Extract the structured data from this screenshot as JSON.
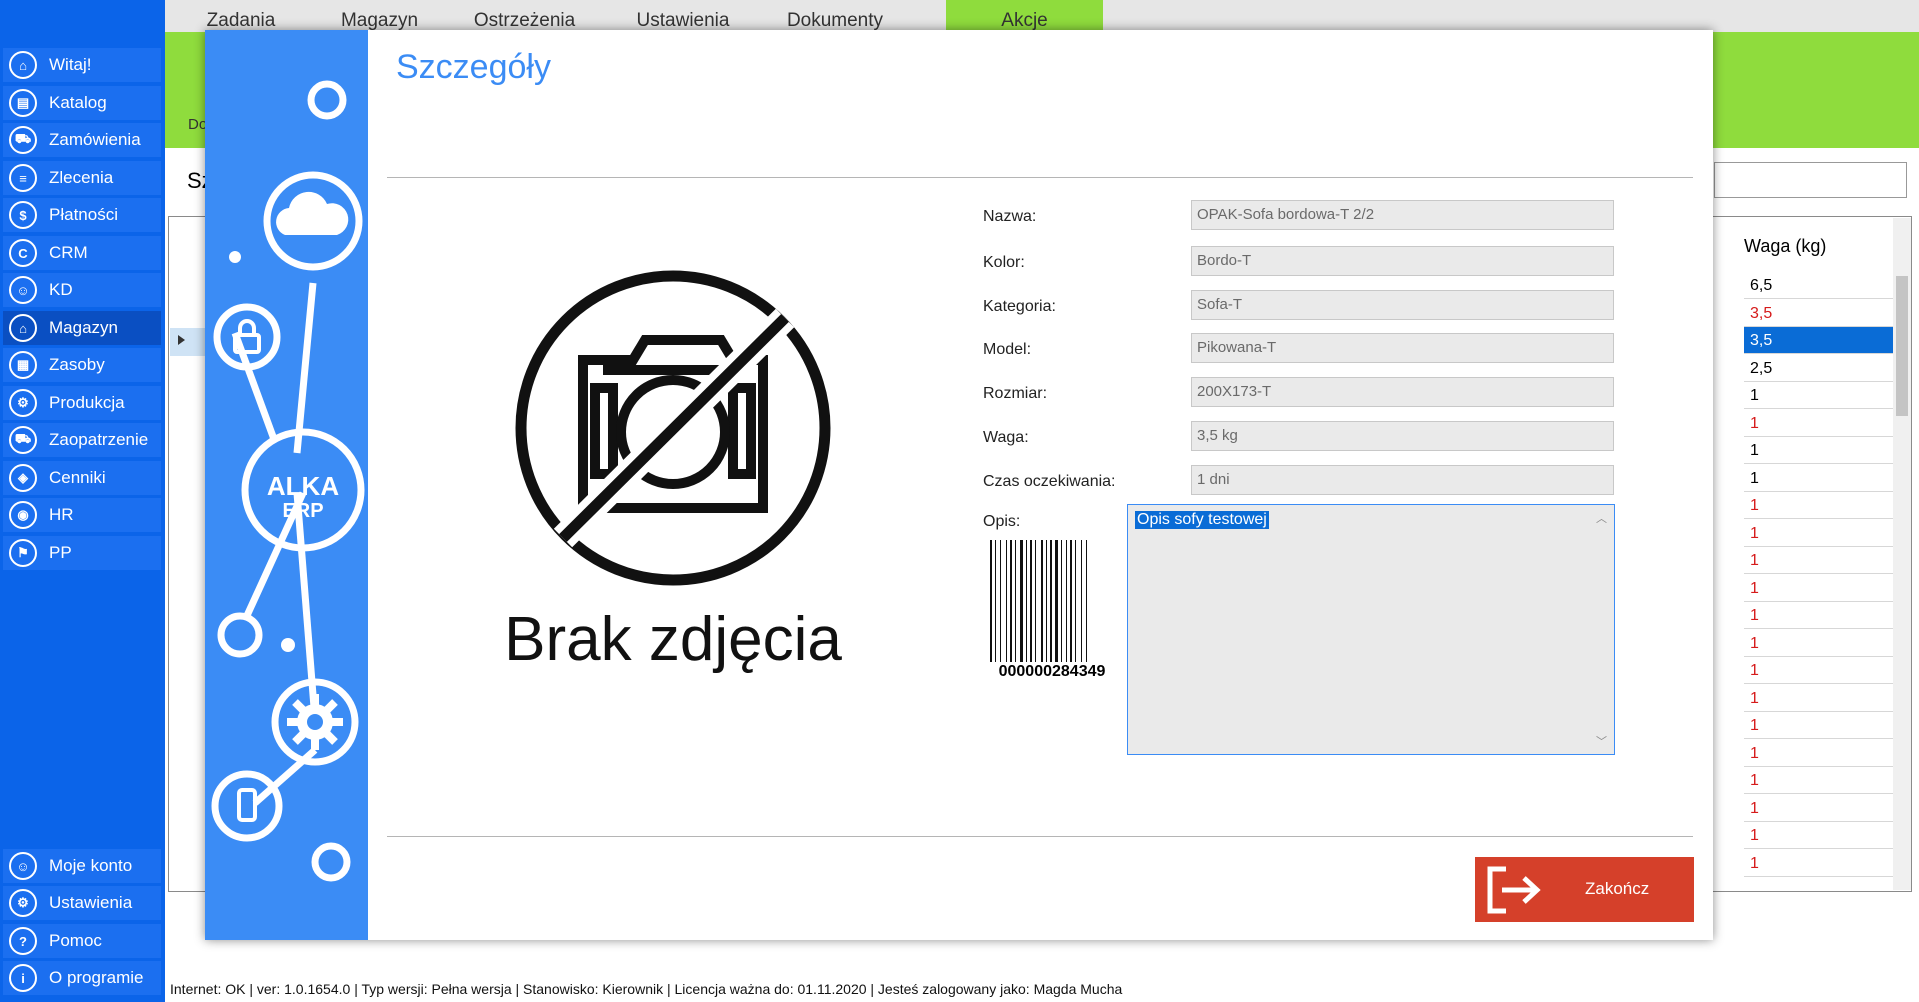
{
  "sidebar": {
    "items": [
      {
        "label": "Witaj!",
        "icon": "home-icon",
        "glyph": "⌂"
      },
      {
        "label": "Katalog",
        "icon": "book-icon",
        "glyph": "▤"
      },
      {
        "label": "Zamówienia",
        "icon": "cart-icon",
        "glyph": "⛟"
      },
      {
        "label": "Zlecenia",
        "icon": "list-icon",
        "glyph": "≡"
      },
      {
        "label": "Płatności",
        "icon": "dollar-icon",
        "glyph": "$"
      },
      {
        "label": "CRM",
        "icon": "crm-icon",
        "glyph": "C"
      },
      {
        "label": "KD",
        "icon": "user-icon",
        "glyph": "☺"
      },
      {
        "label": "Magazyn",
        "icon": "warehouse-icon",
        "glyph": "⌂"
      },
      {
        "label": "Zasoby",
        "icon": "resources-icon",
        "glyph": "▦"
      },
      {
        "label": "Produkcja",
        "icon": "production-icon",
        "glyph": "⚙"
      },
      {
        "label": "Zaopatrzenie",
        "icon": "truck-icon",
        "glyph": "⛟"
      },
      {
        "label": "Cenniki",
        "icon": "tag-icon",
        "glyph": "◈"
      },
      {
        "label": "HR",
        "icon": "hr-icon",
        "glyph": "◉"
      },
      {
        "label": "PP",
        "icon": "pp-icon",
        "glyph": "⚑"
      }
    ],
    "bottom_items": [
      {
        "label": "Moje konto",
        "icon": "account-icon",
        "glyph": "☺"
      },
      {
        "label": "Ustawienia",
        "icon": "settings-icon",
        "glyph": "⚙"
      },
      {
        "label": "Pomoc",
        "icon": "help-icon",
        "glyph": "?"
      },
      {
        "label": "O programie",
        "icon": "info-icon",
        "glyph": "i"
      }
    ]
  },
  "topmenu": {
    "tabs": [
      "Zadania",
      "Magazyn",
      "Ostrzeżenia",
      "Ustawienia",
      "Dokumenty",
      "Akcje"
    ]
  },
  "background": {
    "green_label": "Do",
    "title": "Sz",
    "column_header": "Waga (kg)",
    "rows": [
      "6,5",
      "3,5",
      "3,5",
      "2,5",
      "1",
      "1",
      "1",
      "1",
      "1",
      "1",
      "1",
      "1",
      "1",
      "1",
      "1",
      "1",
      "1",
      "1",
      "1",
      "1",
      "1",
      "1"
    ]
  },
  "modal": {
    "title": "Szczegóły",
    "no_photo_text": "Brak zdjęcia",
    "logo_line1": "ALKA",
    "logo_line2": "ERP",
    "fields": [
      {
        "label": "Nazwa:",
        "value": "OPAK-Sofa bordowa-T   2/2"
      },
      {
        "label": "Kolor:",
        "value": "Bordo-T"
      },
      {
        "label": "Kategoria:",
        "value": "Sofa-T"
      },
      {
        "label": "Model:",
        "value": "Pikowana-T"
      },
      {
        "label": "Rozmiar:",
        "value": "200X173-T"
      },
      {
        "label": "Waga:",
        "value": "3,5 kg"
      },
      {
        "label": "Czas oczekiwania:",
        "value": "1 dni"
      }
    ],
    "description_label": "Opis:",
    "description_value": "Opis sofy testowej",
    "barcode_number": "000000284349",
    "close_label": "Zakończ"
  },
  "statusbar": {
    "text": "Internet: OK  |   ver: 1.0.1654.0   |   Typ wersji: Pełna wersja   |   Stanowisko: Kierownik   |   Licencja ważna do: 01.11.2020   |   Jesteś zalogowany jako: Magda Mucha"
  },
  "colors": {
    "sidebar_blue": "#0b64e9",
    "modal_blue": "#3b8cf5",
    "green": "#8fdc3d",
    "close_red": "#d5402a",
    "selection_blue": "#0a6cd6"
  }
}
